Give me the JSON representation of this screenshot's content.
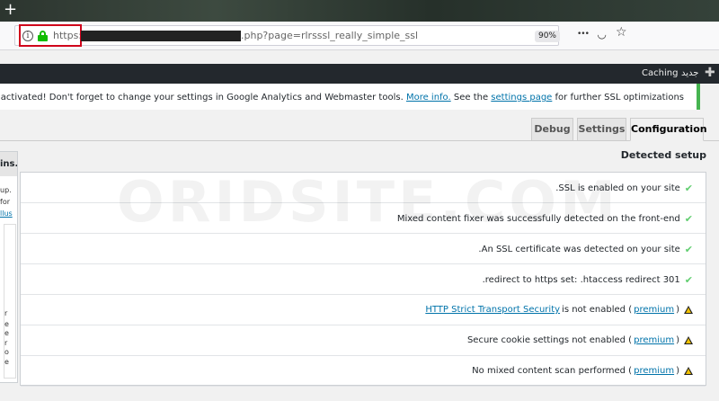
{
  "browser": {
    "new_tab_glyph": "+",
    "url_scheme": "https://",
    "url_path": ".php?page=rlrsssl_really_simple_ssl",
    "zoom": "90%",
    "info_glyph": "i",
    "more_glyph": "•••",
    "pocket_glyph": "◡",
    "star_glyph": "☆"
  },
  "adminbar": {
    "caching": "Caching",
    "new": "جديد",
    "plus_glyph": "✚"
  },
  "notice": {
    "part1": ".SSL activated!  Don't forget to change your settings in Google Analytics and Webmaster tools. ",
    "link1": "More info.",
    "part2": " See the ",
    "link2": "settings page",
    "part3": " for further SSL optimizations",
    "accent": "#46b450"
  },
  "tabs": [
    {
      "label": "Debug"
    },
    {
      "label": "Settings"
    },
    {
      "label": "Configuration"
    }
  ],
  "left_panel": {
    "heading": "ins.",
    "lines": [
      "up.",
      "for",
      "llus",
      "r",
      "e",
      "e",
      "r",
      "o",
      "e"
    ]
  },
  "detected": {
    "title": "Detected setup",
    "rows": [
      {
        "pre": "",
        "link": "",
        "text": ".SSL is enabled on your site",
        "premium": "",
        "status": "ok"
      },
      {
        "pre": "",
        "link": "",
        "text": "Mixed content fixer was successfully detected on the front-end",
        "premium": "",
        "status": "ok"
      },
      {
        "pre": "",
        "link": "",
        "text": ".An SSL certificate was detected on your site",
        "premium": "",
        "status": "ok"
      },
      {
        "pre": "",
        "link": "",
        "text": ".redirect to https set: .htaccess redirect 301",
        "premium": "",
        "status": "ok"
      },
      {
        "pre": "",
        "link": "HTTP Strict Transport Security",
        "text": " is not enabled (",
        "premium": "premium",
        "close": ")",
        "status": "warn"
      },
      {
        "pre": "",
        "link": "",
        "text": "Secure cookie settings not enabled (",
        "premium": "premium",
        "close": ")",
        "status": "warn"
      },
      {
        "pre": "",
        "link": "",
        "text": "No mixed content scan performed (",
        "premium": "premium",
        "close": ")",
        "status": "warn"
      }
    ]
  },
  "watermark": "ORIDSITE.COM",
  "colors": {
    "ok": "#61ce70",
    "warn": "#f0c000",
    "link": "#0073aa",
    "highlight": "#d0021b"
  }
}
